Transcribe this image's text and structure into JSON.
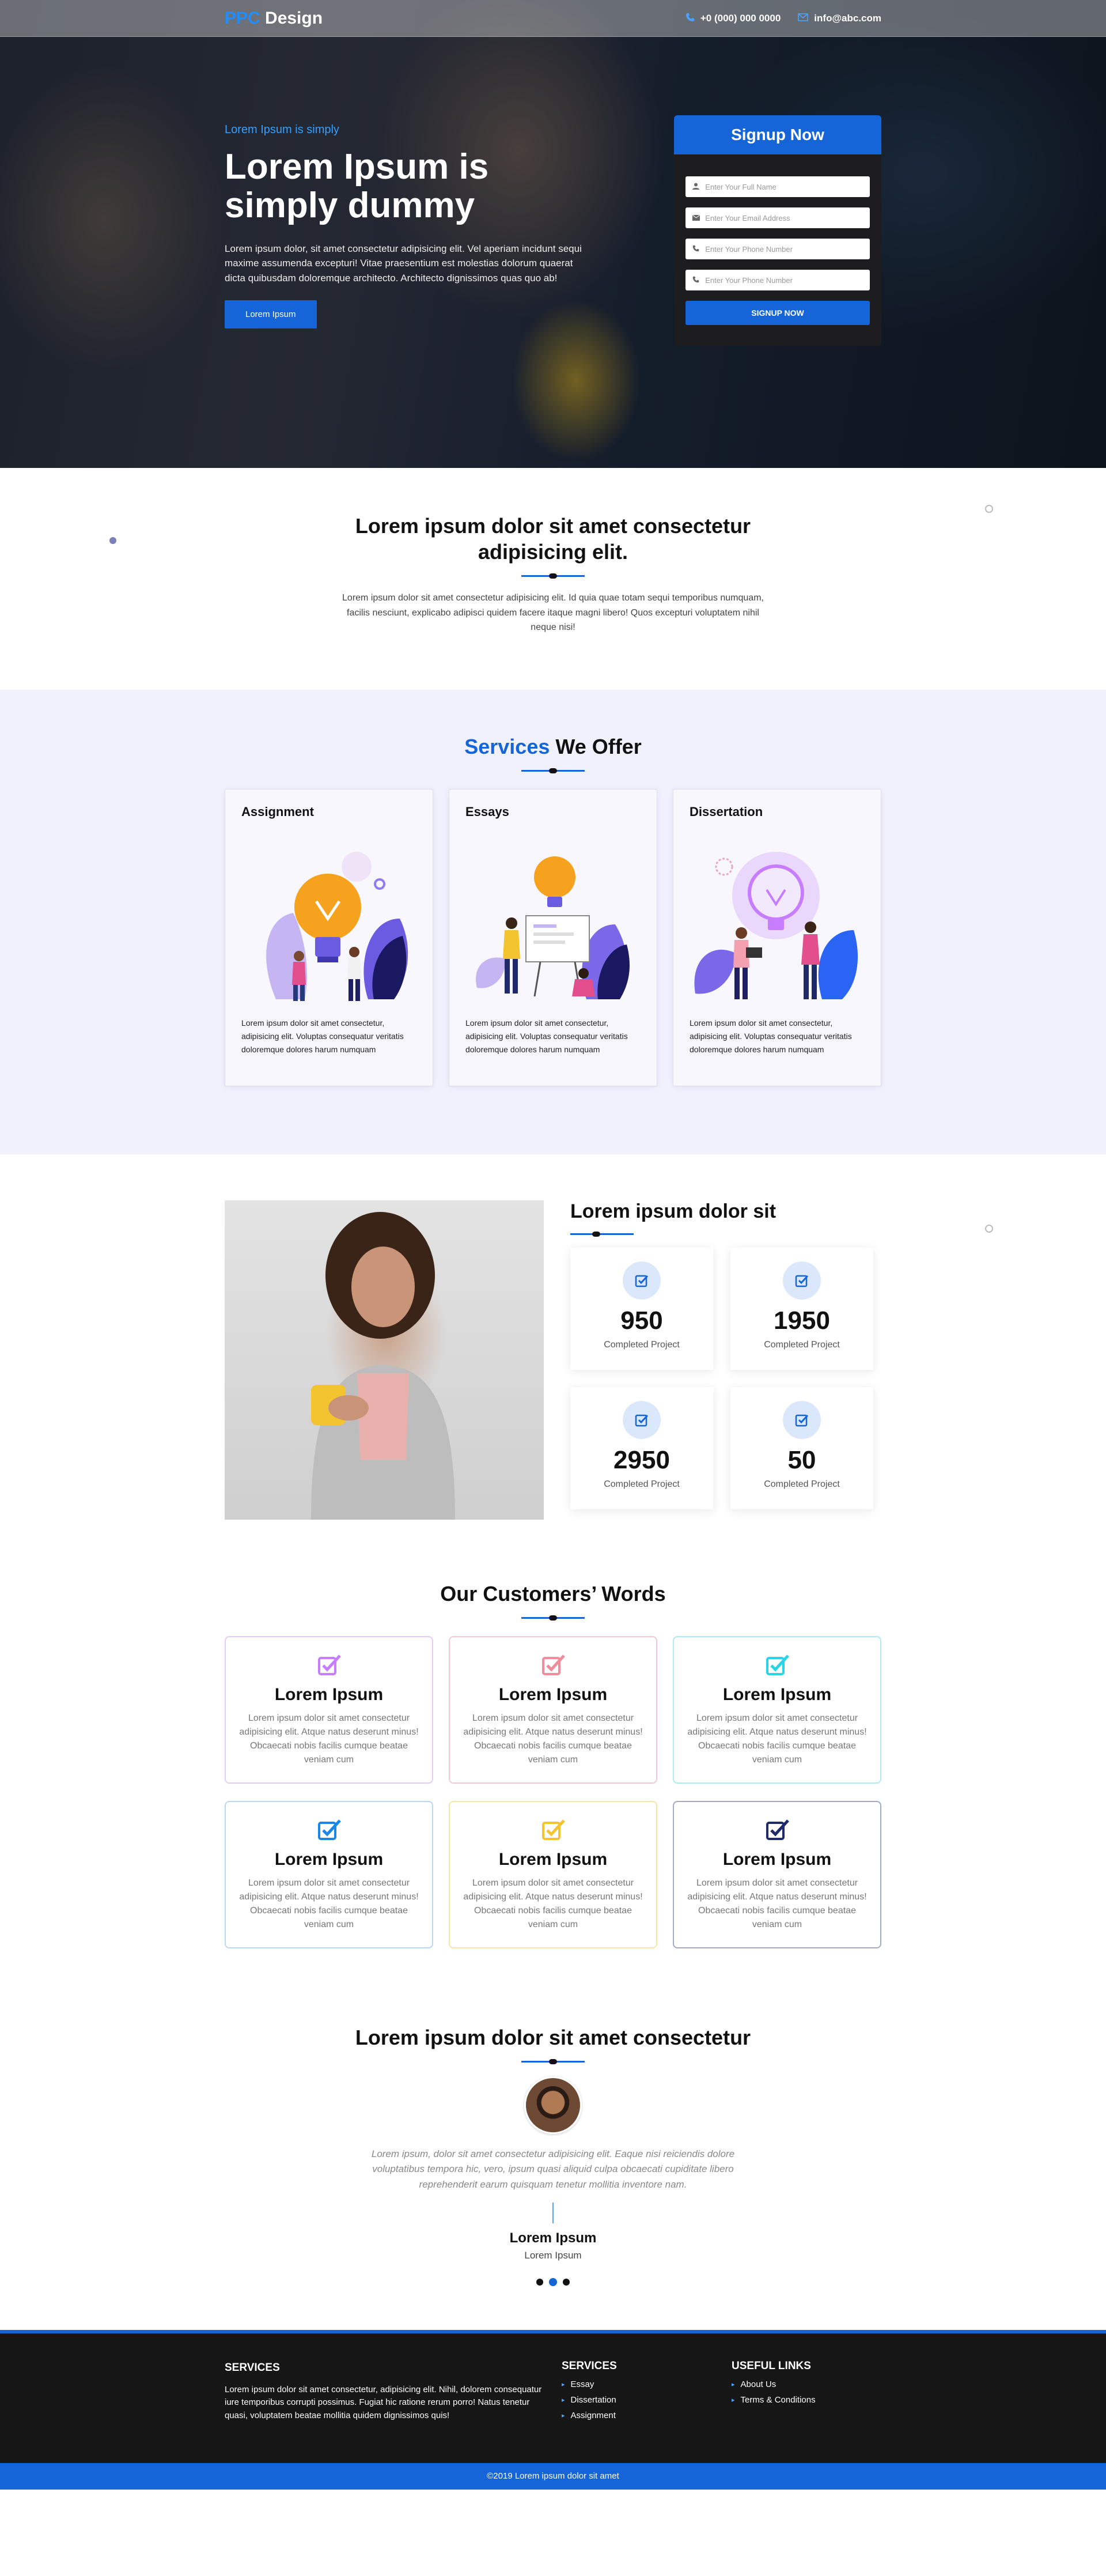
{
  "header": {
    "logo_accent": "PPC",
    "logo_rest": " Design",
    "phone": "+0 (000) 000 0000",
    "email": "info@abc.com",
    "phone_icon": "phone-icon",
    "email_icon": "mail-icon"
  },
  "hero": {
    "kicker": "Lorem Ipsum is simply",
    "title": "Lorem Ipsum is simply dummy",
    "description": "Lorem ipsum dolor, sit amet consectetur adipisicing elit. Vel aperiam incidunt sequi maxime assumenda excepturi! Vitae praesentium est molestias dolorum quaerat dicta quibusdam doloremque architecto. Architecto dignissimos quas quo ab!",
    "button": "Lorem Ipsum"
  },
  "signup": {
    "title": "Signup Now",
    "fields": [
      {
        "placeholder": "Enter Your Full Name",
        "icon": "user-icon"
      },
      {
        "placeholder": "Enter Your Email Address",
        "icon": "envelope-icon"
      },
      {
        "placeholder": "Enter Your Phone Number",
        "icon": "phone-icon"
      },
      {
        "placeholder": "Enter Your Phone Number",
        "icon": "phone-icon"
      }
    ],
    "button": "SIGNUP NOW"
  },
  "intro": {
    "title": "Lorem ipsum dolor sit amet consectetur adipisicing elit.",
    "text": "Lorem ipsum dolor sit amet consectetur adipisicing elit. Id quia quae totam sequi temporibus numquam, facilis nesciunt, explicabo adipisci quidem facere itaque magni libero! Quos excepturi voluptatem nihil neque nisi!"
  },
  "services": {
    "title_accent": "Services",
    "title_rest": " We Offer",
    "cards": [
      {
        "title": "Assignment",
        "text": "Lorem ipsum dolor sit amet consectetur, adipisicing elit. Voluptas consequatur veritatis doloremque dolores harum numquam"
      },
      {
        "title": "Essays",
        "text": "Lorem ipsum dolor sit amet consectetur, adipisicing elit. Voluptas consequatur veritatis doloremque dolores harum numquam"
      },
      {
        "title": "Dissertation",
        "text": "Lorem ipsum dolor sit amet consectetur, adipisicing elit. Voluptas consequatur veritatis doloremque dolores harum numquam"
      }
    ]
  },
  "stats": {
    "title": "Lorem ipsum dolor sit",
    "items": [
      {
        "number": "950",
        "label": "Completed Project",
        "icon": "check-square-icon"
      },
      {
        "number": "1950",
        "label": "Completed Project",
        "icon": "check-square-icon"
      },
      {
        "number": "2950",
        "label": "Completed Project",
        "icon": "check-square-icon"
      },
      {
        "number": "50",
        "label": "Completed Project",
        "icon": "check-square-icon"
      }
    ]
  },
  "words": {
    "title": "Our Customers’ Words",
    "items": [
      {
        "title": "Lorem Ipsum",
        "text": "Lorem ipsum dolor sit amet consectetur adipisicing elit. Atque natus deserunt minus! Obcaecati nobis facilis cumque beatae veniam cum",
        "color": "#c77dff"
      },
      {
        "title": "Lorem Ipsum",
        "text": "Lorem ipsum dolor sit amet consectetur adipisicing elit. Atque natus deserunt minus! Obcaecati nobis facilis cumque beatae veniam cum",
        "color": "#f28b9a"
      },
      {
        "title": "Lorem Ipsum",
        "text": "Lorem ipsum dolor sit amet consectetur adipisicing elit. Atque natus deserunt minus! Obcaecati nobis facilis cumque beatae veniam cum",
        "color": "#2bd3e6"
      },
      {
        "title": "Lorem Ipsum",
        "text": "Lorem ipsum dolor sit amet consectetur adipisicing elit. Atque natus deserunt minus! Obcaecati nobis facilis cumque beatae veniam cum",
        "color": "#1a86e8"
      },
      {
        "title": "Lorem Ipsum",
        "text": "Lorem ipsum dolor sit amet consectetur adipisicing elit. Atque natus deserunt minus! Obcaecati nobis facilis cumque beatae veniam cum",
        "color": "#f4c430"
      },
      {
        "title": "Lorem Ipsum",
        "text": "Lorem ipsum dolor sit amet consectetur adipisicing elit. Atque natus deserunt minus! Obcaecati nobis facilis cumque beatae veniam cum",
        "color": "#1f2a6b"
      }
    ]
  },
  "testimonial": {
    "title": "Lorem ipsum dolor sit amet consectetur",
    "quote": "Lorem ipsum, dolor sit amet consectetur adipisicing elit. Eaque nisi reiciendis dolore voluptatibus tempora hic, vero, ipsum quasi aliquid culpa obcaecati cupiditate libero reprehenderit earum quisquam tenetur mollitia inventore nam.",
    "name": "Lorem Ipsum",
    "role": "Lorem Ipsum"
  },
  "footer": {
    "about_title": "SERVICES",
    "about_text": "Lorem ipsum dolor sit amet consectetur, adipisicing elit. Nihil, dolorem consequatur iure temporibus corrupti possimus. Fugiat hic ratione rerum porro! Natus tenetur quasi, voluptatem beatae mollitia quidem dignissimos quis!",
    "services_title": "SERVICES",
    "services": [
      "Essay",
      "Dissertation",
      "Assignment"
    ],
    "links_title": "USEFUL LINKS",
    "links": [
      "About Us",
      "Terms & Conditions"
    ],
    "copyright": "©2019 Lorem ipsum dolor sit amet"
  }
}
